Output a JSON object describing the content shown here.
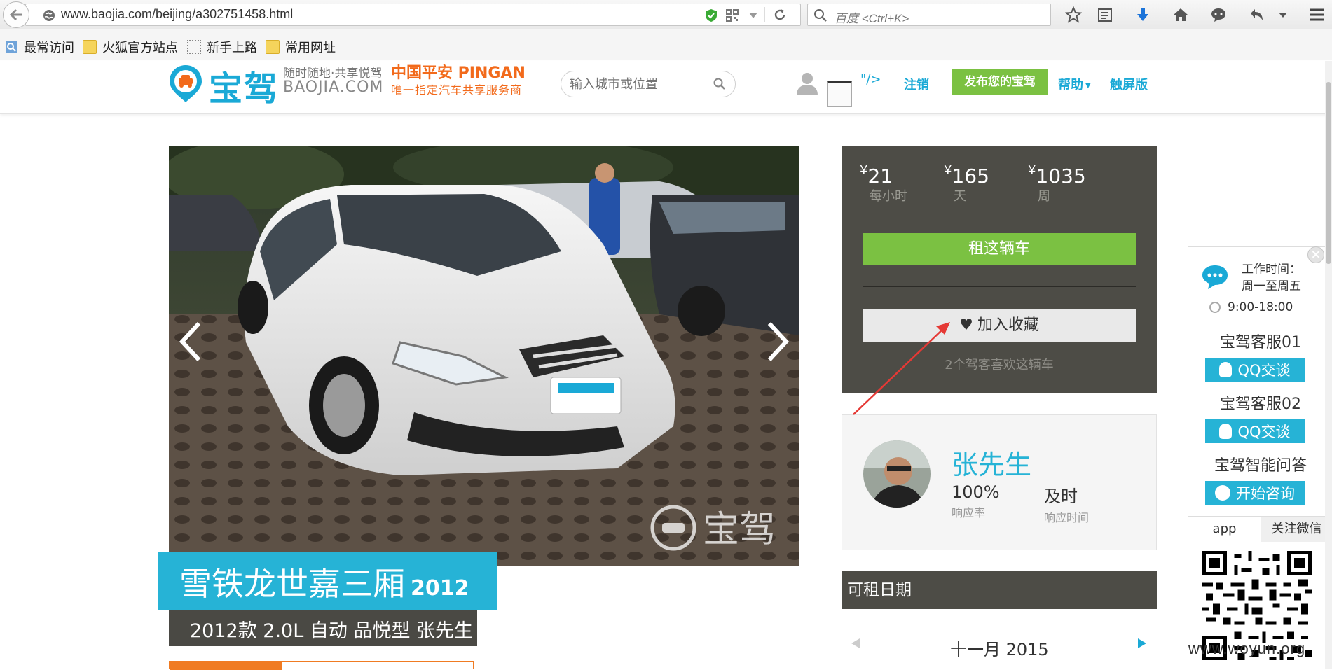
{
  "browser": {
    "url": "www.baojia.com/beijing/a302751458.html",
    "search_placeholder": "百度 <Ctrl+K>",
    "bookmarks": [
      "最常访问",
      "火狐官方站点",
      "新手上路",
      "常用网址"
    ]
  },
  "site": {
    "logo_text": "宝驾",
    "slogan_cn": "随时随地·共享悦驾",
    "slogan_en": "BAOJIA.COM",
    "partner_name": "中国平安 PINGAN",
    "partner_sub": "唯一指定汽车共享服务商",
    "city_search_placeholder": "输入城市或位置",
    "broken_tag": "\"/>",
    "nav": {
      "logout": "注销",
      "publish": "发布您的宝驾",
      "help": "帮助",
      "touch": "触屏版"
    },
    "accent": "#26b3d6",
    "green": "#7bc142"
  },
  "car": {
    "title": "雪铁龙世嘉三厢",
    "year": "2012",
    "subtitle": "2012款 2.0L 自动 品悦型 张先生",
    "photo_watermark": "宝驾"
  },
  "pricing": {
    "currency": "¥",
    "hour": {
      "value": "21",
      "unit": "每小时"
    },
    "day": {
      "value": "165",
      "unit": "天"
    },
    "week": {
      "value": "1035",
      "unit": "周"
    },
    "rent_button": "租这辆车",
    "favorite_button": "加入收藏",
    "likes_text": "2个驾客喜欢这辆车"
  },
  "owner": {
    "name": "张先生",
    "response_rate": {
      "value": "100%",
      "label": "响应率"
    },
    "response_time": {
      "value": "及时",
      "label": "响应时间"
    }
  },
  "availability": {
    "heading": "可租日期",
    "month": "十一月 2015"
  },
  "support": {
    "work_label": "工作时间：",
    "work_days": "周一至周五",
    "work_hours": "9:00-18:00",
    "agent1": "宝驾客服01",
    "agent2": "宝驾客服02",
    "qq_button": "QQ交谈",
    "ai_title": "宝驾智能问答",
    "ai_button": "开始咨询",
    "tab_app": "app",
    "tab_wechat": "关注微信",
    "close": "×"
  },
  "watermark": "www.woyun.org"
}
